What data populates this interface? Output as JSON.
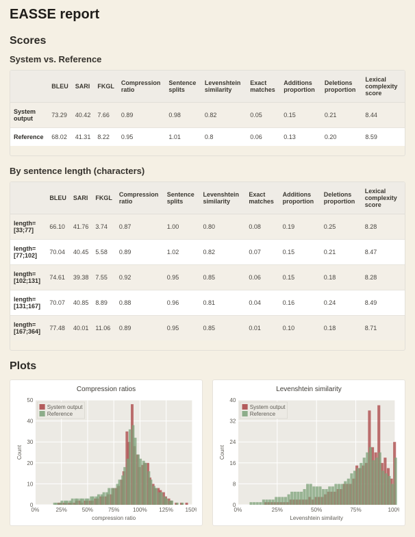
{
  "page_title": "EASSE report",
  "sections": {
    "scores": "Scores",
    "sys_vs_ref": "System vs. Reference",
    "by_len": "By sentence length (characters)",
    "plots": "Plots"
  },
  "sysref": {
    "headers": [
      "",
      "BLEU",
      "SARI",
      "FKGL",
      "Compression ratio",
      "Sentence splits",
      "Levenshtein similarity",
      "Exact matches",
      "Additions proportion",
      "Deletions proportion",
      "Lexical complexity score"
    ],
    "rows": [
      {
        "label": "System output",
        "vals": [
          "73.29",
          "40.42",
          "7.66",
          "0.89",
          "0.98",
          "0.82",
          "0.05",
          "0.15",
          "0.21",
          "8.44"
        ]
      },
      {
        "label": "Reference",
        "vals": [
          "68.02",
          "41.31",
          "8.22",
          "0.95",
          "1.01",
          "0.8",
          "0.06",
          "0.13",
          "0.20",
          "8.59"
        ]
      }
    ]
  },
  "bylen": {
    "headers": [
      "",
      "BLEU",
      "SARI",
      "FKGL",
      "Compression ratio",
      "Sentence splits",
      "Levenshtein similarity",
      "Exact matches",
      "Additions proportion",
      "Deletions proportion",
      "Lexical complexity score"
    ],
    "rows": [
      {
        "label": "length=[33;77]",
        "vals": [
          "66.10",
          "41.76",
          "3.74",
          "0.87",
          "1.00",
          "0.80",
          "0.08",
          "0.19",
          "0.25",
          "8.28"
        ]
      },
      {
        "label": "length=[77;102]",
        "vals": [
          "70.04",
          "40.45",
          "5.58",
          "0.89",
          "1.02",
          "0.82",
          "0.07",
          "0.15",
          "0.21",
          "8.47"
        ]
      },
      {
        "label": "length=[102;131]",
        "vals": [
          "74.61",
          "39.38",
          "7.55",
          "0.92",
          "0.95",
          "0.85",
          "0.06",
          "0.15",
          "0.18",
          "8.28"
        ]
      },
      {
        "label": "length=[131;167]",
        "vals": [
          "70.07",
          "40.85",
          "8.89",
          "0.88",
          "0.96",
          "0.81",
          "0.04",
          "0.16",
          "0.24",
          "8.49"
        ]
      },
      {
        "label": "length=[167;364]",
        "vals": [
          "77.48",
          "40.01",
          "11.06",
          "0.89",
          "0.95",
          "0.85",
          "0.01",
          "0.10",
          "0.18",
          "8.71"
        ]
      }
    ]
  },
  "chart_data": [
    {
      "type": "bar",
      "title": "Compression ratios",
      "xlabel": "compression ratio",
      "ylabel": "Count",
      "ylim": [
        0,
        50
      ],
      "xlim": [
        0,
        150
      ],
      "legend": [
        "System output",
        "Reference"
      ],
      "legend_pos": "upper-left",
      "series": [
        {
          "name": "System output",
          "color": "#a94344",
          "x": [
            5,
            10,
            15,
            18,
            20,
            23,
            25,
            28,
            30,
            33,
            35,
            38,
            40,
            43,
            45,
            48,
            50,
            53,
            55,
            58,
            60,
            63,
            65,
            68,
            70,
            73,
            75,
            78,
            80,
            83,
            85,
            88,
            90,
            93,
            95,
            98,
            100,
            103,
            105,
            108,
            110,
            113,
            115,
            118,
            120,
            123,
            125,
            128,
            130,
            135,
            140,
            145
          ],
          "y": [
            0,
            0,
            0,
            0,
            0,
            1,
            1,
            1,
            1,
            1,
            1,
            1,
            2,
            2,
            1,
            2,
            2,
            2,
            2,
            3,
            3,
            4,
            4,
            4,
            5,
            5,
            8,
            8,
            9,
            12,
            16,
            35,
            30,
            48,
            28,
            24,
            18,
            19,
            20,
            20,
            13,
            10,
            8,
            8,
            7,
            6,
            4,
            3,
            2,
            1,
            1,
            1
          ]
        },
        {
          "name": "Reference",
          "color": "#7da27a",
          "x": [
            5,
            10,
            15,
            18,
            20,
            23,
            25,
            28,
            30,
            33,
            35,
            38,
            40,
            43,
            45,
            48,
            50,
            53,
            55,
            58,
            60,
            63,
            65,
            68,
            70,
            73,
            75,
            78,
            80,
            83,
            85,
            88,
            90,
            93,
            95,
            98,
            100,
            103,
            105,
            108,
            110,
            113,
            115,
            118,
            120,
            123,
            125,
            128,
            130,
            135,
            140,
            145
          ],
          "y": [
            0,
            0,
            0,
            1,
            1,
            1,
            2,
            2,
            2,
            2,
            3,
            3,
            3,
            3,
            3,
            3,
            3,
            4,
            4,
            4,
            5,
            5,
            6,
            6,
            8,
            8,
            8,
            10,
            12,
            14,
            18,
            22,
            36,
            38,
            32,
            24,
            22,
            21,
            20,
            16,
            12,
            9,
            8,
            6,
            6,
            4,
            3,
            2,
            2,
            1,
            1,
            0
          ]
        }
      ]
    },
    {
      "type": "bar",
      "title": "Levenshtein similarity",
      "xlabel": "Levenshtein similarity",
      "ylabel": "Count",
      "ylim": [
        0,
        40
      ],
      "xlim": [
        0,
        100
      ],
      "legend": [
        "System output",
        "Reference"
      ],
      "legend_pos": "upper-left",
      "series": [
        {
          "name": "System output",
          "color": "#a94344",
          "x": [
            2,
            4,
            6,
            8,
            10,
            12,
            14,
            16,
            18,
            20,
            22,
            24,
            26,
            28,
            30,
            32,
            34,
            36,
            38,
            40,
            42,
            44,
            46,
            48,
            50,
            52,
            54,
            56,
            58,
            60,
            62,
            64,
            66,
            68,
            70,
            72,
            74,
            76,
            78,
            80,
            82,
            84,
            86,
            88,
            90,
            92,
            94,
            96,
            98,
            100
          ],
          "y": [
            0,
            0,
            0,
            0,
            0,
            0,
            0,
            0,
            1,
            1,
            1,
            1,
            1,
            1,
            1,
            1,
            2,
            2,
            2,
            2,
            2,
            2,
            3,
            2,
            3,
            3,
            3,
            4,
            5,
            5,
            5,
            6,
            6,
            8,
            8,
            8,
            10,
            15,
            14,
            15,
            16,
            36,
            22,
            20,
            38,
            16,
            18,
            14,
            10,
            24
          ]
        },
        {
          "name": "Reference",
          "color": "#7da27a",
          "x": [
            2,
            4,
            6,
            8,
            10,
            12,
            14,
            16,
            18,
            20,
            22,
            24,
            26,
            28,
            30,
            32,
            34,
            36,
            38,
            40,
            42,
            44,
            46,
            48,
            50,
            52,
            54,
            56,
            58,
            60,
            62,
            64,
            66,
            68,
            70,
            72,
            74,
            76,
            78,
            80,
            82,
            84,
            86,
            88,
            90,
            92,
            94,
            96,
            98,
            100
          ],
          "y": [
            0,
            0,
            0,
            1,
            1,
            1,
            1,
            2,
            2,
            2,
            2,
            3,
            3,
            3,
            3,
            4,
            5,
            5,
            5,
            5,
            6,
            8,
            8,
            7,
            7,
            7,
            6,
            6,
            7,
            7,
            8,
            8,
            8,
            9,
            10,
            12,
            13,
            14,
            16,
            18,
            20,
            22,
            17,
            18,
            20,
            13,
            12,
            11,
            8,
            18
          ]
        }
      ]
    }
  ]
}
